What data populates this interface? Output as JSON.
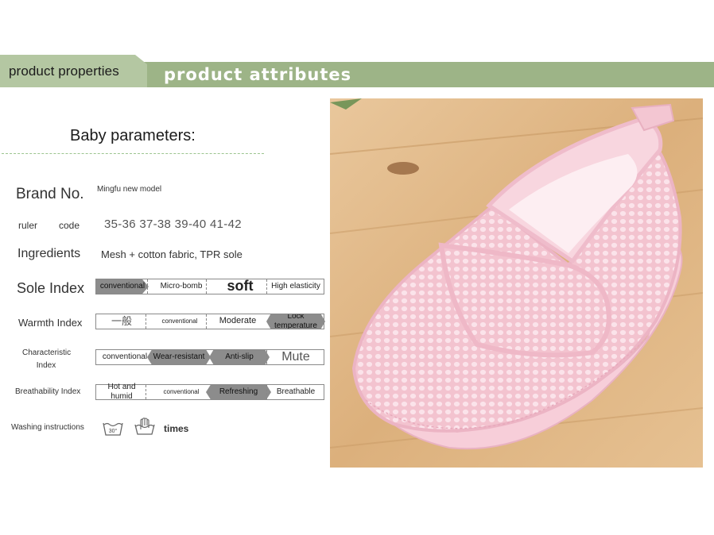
{
  "header": {
    "left_label": "product properties",
    "right_label": "product attributes",
    "colors": {
      "band": "#9db487",
      "tab": "#b4c7a2"
    }
  },
  "section": {
    "title": "Baby parameters:"
  },
  "brand": {
    "label": "Brand No.",
    "value": "Mingfu new model"
  },
  "ruler": {
    "label": "ruler",
    "code_label": "code",
    "sizes": "35-36 37-38 39-40 41-42"
  },
  "ingredients": {
    "label": "Ingredients",
    "value": "Mesh + cotton fabric, TPR sole"
  },
  "sole_index": {
    "label": "Sole Index",
    "options": [
      "conventional",
      "Micro-bomb",
      "soft",
      "High elasticity"
    ],
    "selected": "conventional"
  },
  "warmth_index": {
    "label": "Warmth Index",
    "options": [
      "一般",
      "conventional",
      "Moderate",
      "Lock temperature"
    ],
    "selected": "Lock temperature"
  },
  "characteristic_index": {
    "label": "Characteristic Index",
    "options": [
      "conventional",
      "Wear-resistant",
      "Anti-slip",
      "Mute"
    ],
    "selected": [
      "Wear-resistant",
      "Anti-slip"
    ]
  },
  "breathability_index": {
    "label": "Breathability Index",
    "options": [
      "Hot and humid",
      "conventional",
      "Refreshing",
      "Breathable"
    ],
    "selected": "Refreshing"
  },
  "washing": {
    "label": "Washing instructions",
    "icons": [
      "wash-30-icon",
      "hand-wash-icon"
    ],
    "temp": "30°",
    "times_label": "times"
  },
  "product_image": {
    "subject": "pink-mesh-slip-on-shoe",
    "colors": {
      "wood": "#e4bd8a",
      "shoe": "#f4c6d2"
    }
  }
}
